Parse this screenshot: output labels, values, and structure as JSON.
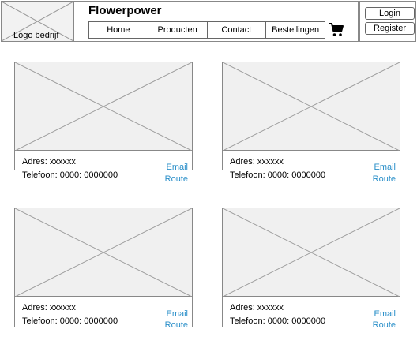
{
  "header": {
    "logo_label": "Logo bedrijf",
    "brand": "Flowerpower",
    "nav": [
      "Home",
      "Producten",
      "Contact",
      "Bestellingen"
    ],
    "cart_icon": "shopping-cart-icon",
    "login_label": "Login",
    "register_label": "Register"
  },
  "cards": [
    {
      "address": "Adres: xxxxxx",
      "phone": "Telefoon: 0000: 0000000",
      "email": "Email",
      "route": "Route"
    },
    {
      "address": "Adres: xxxxxx",
      "phone": "Telefoon: 0000: 0000000",
      "email": "Email",
      "route": "Route"
    },
    {
      "address": "Adres: xxxxxx",
      "phone": "Telefoon: 0000: 0000000",
      "email": "Email",
      "route": "Route"
    },
    {
      "address": "Adres: xxxxxx",
      "phone": "Telefoon: 0000: 0000000",
      "email": "Email",
      "route": "Route"
    }
  ],
  "colors": {
    "link": "#2a8fc9",
    "placeholder_bg": "#f0f0f0",
    "border": "#888888"
  }
}
